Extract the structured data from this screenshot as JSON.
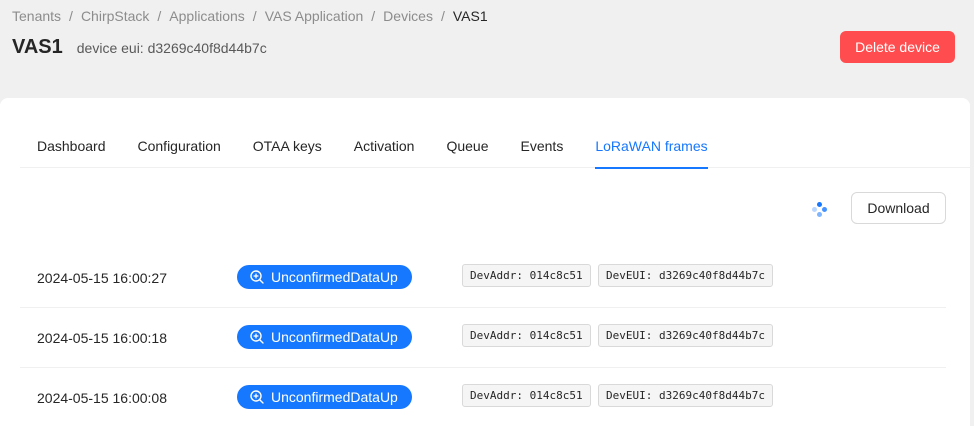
{
  "breadcrumb": [
    {
      "label": "Tenants"
    },
    {
      "label": "ChirpStack"
    },
    {
      "label": "Applications"
    },
    {
      "label": "VAS Application"
    },
    {
      "label": "Devices"
    },
    {
      "label": "VAS1"
    }
  ],
  "breadcrumb_separator": "/",
  "header": {
    "title": "VAS1",
    "subtitle": "device eui: d3269c40f8d44b7c",
    "delete_label": "Delete device"
  },
  "tabs": [
    {
      "label": "Dashboard",
      "active": false
    },
    {
      "label": "Configuration",
      "active": false
    },
    {
      "label": "OTAA keys",
      "active": false
    },
    {
      "label": "Activation",
      "active": false
    },
    {
      "label": "Queue",
      "active": false
    },
    {
      "label": "Events",
      "active": false
    },
    {
      "label": "LoRaWAN frames",
      "active": true
    }
  ],
  "toolbar": {
    "download_label": "Download",
    "loading_icon": "loading-spinner-icon"
  },
  "frames": [
    {
      "time": "2024-05-15 16:00:27",
      "type": "UnconfirmedDataUp",
      "devaddr": "DevAddr: 014c8c51",
      "deveui": "DevEUI: d3269c40f8d44b7c"
    },
    {
      "time": "2024-05-15 16:00:18",
      "type": "UnconfirmedDataUp",
      "devaddr": "DevAddr: 014c8c51",
      "deveui": "DevEUI: d3269c40f8d44b7c"
    },
    {
      "time": "2024-05-15 16:00:08",
      "type": "UnconfirmedDataUp",
      "devaddr": "DevAddr: 014c8c51",
      "deveui": "DevEUI: d3269c40f8d44b7c"
    }
  ],
  "colors": {
    "accent": "#1677ff",
    "danger": "#ff4d4f"
  }
}
